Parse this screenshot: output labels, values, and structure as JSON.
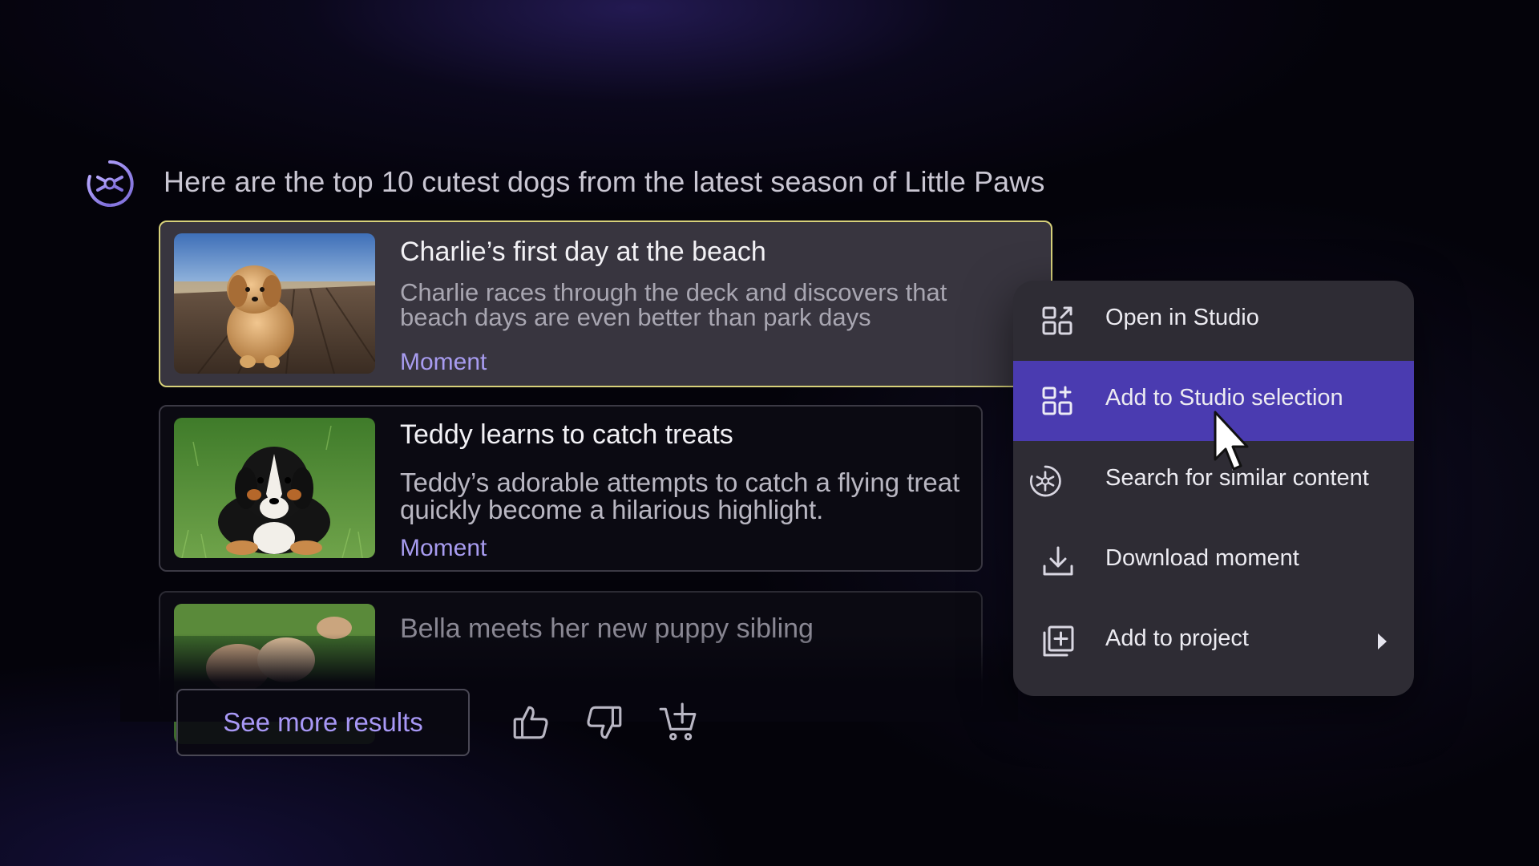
{
  "assistant": {
    "icon": "sparkle-compass-icon",
    "message": "Here are the top 10 cutest dogs from the latest season of Little Paws"
  },
  "results": [
    {
      "title": "Charlie’s first day at the beach",
      "description": "Charlie races through the deck and  discovers that beach days are even better than park days",
      "type": "Moment",
      "thumbnail": "fluffy-puppy-on-deck",
      "selected": true
    },
    {
      "title": "Teddy learns to catch treats",
      "description": "Teddy’s adorable attempts to catch a flying treat quickly become a hilarious highlight.",
      "type": "Moment",
      "thumbnail": "bernese-puppy-on-grass",
      "selected": false
    },
    {
      "title": "Bella meets her new puppy sibling",
      "thumbnail": "puppies-on-grass",
      "selected": false
    }
  ],
  "footer": {
    "see_more_label": "See more results",
    "actions": [
      {
        "icon": "thumbs-up-icon"
      },
      {
        "icon": "thumbs-down-icon"
      },
      {
        "icon": "add-to-cart-icon"
      }
    ]
  },
  "context_menu": {
    "items": [
      {
        "label": "Open in Studio",
        "icon": "open-studio-icon",
        "active": false
      },
      {
        "label": "Add to Studio selection",
        "icon": "add-studio-icon",
        "active": true
      },
      {
        "label": "Search for similar content",
        "icon": "sparkle-search-icon",
        "active": false
      },
      {
        "label": "Download moment",
        "icon": "download-icon",
        "active": false
      },
      {
        "label": "Add to project",
        "icon": "add-project-icon",
        "active": false,
        "has_submenu": true
      }
    ]
  },
  "colors": {
    "accent": "#a898f6",
    "menu_active": "#4a3bb0",
    "selected_border": "#d7d17a"
  }
}
